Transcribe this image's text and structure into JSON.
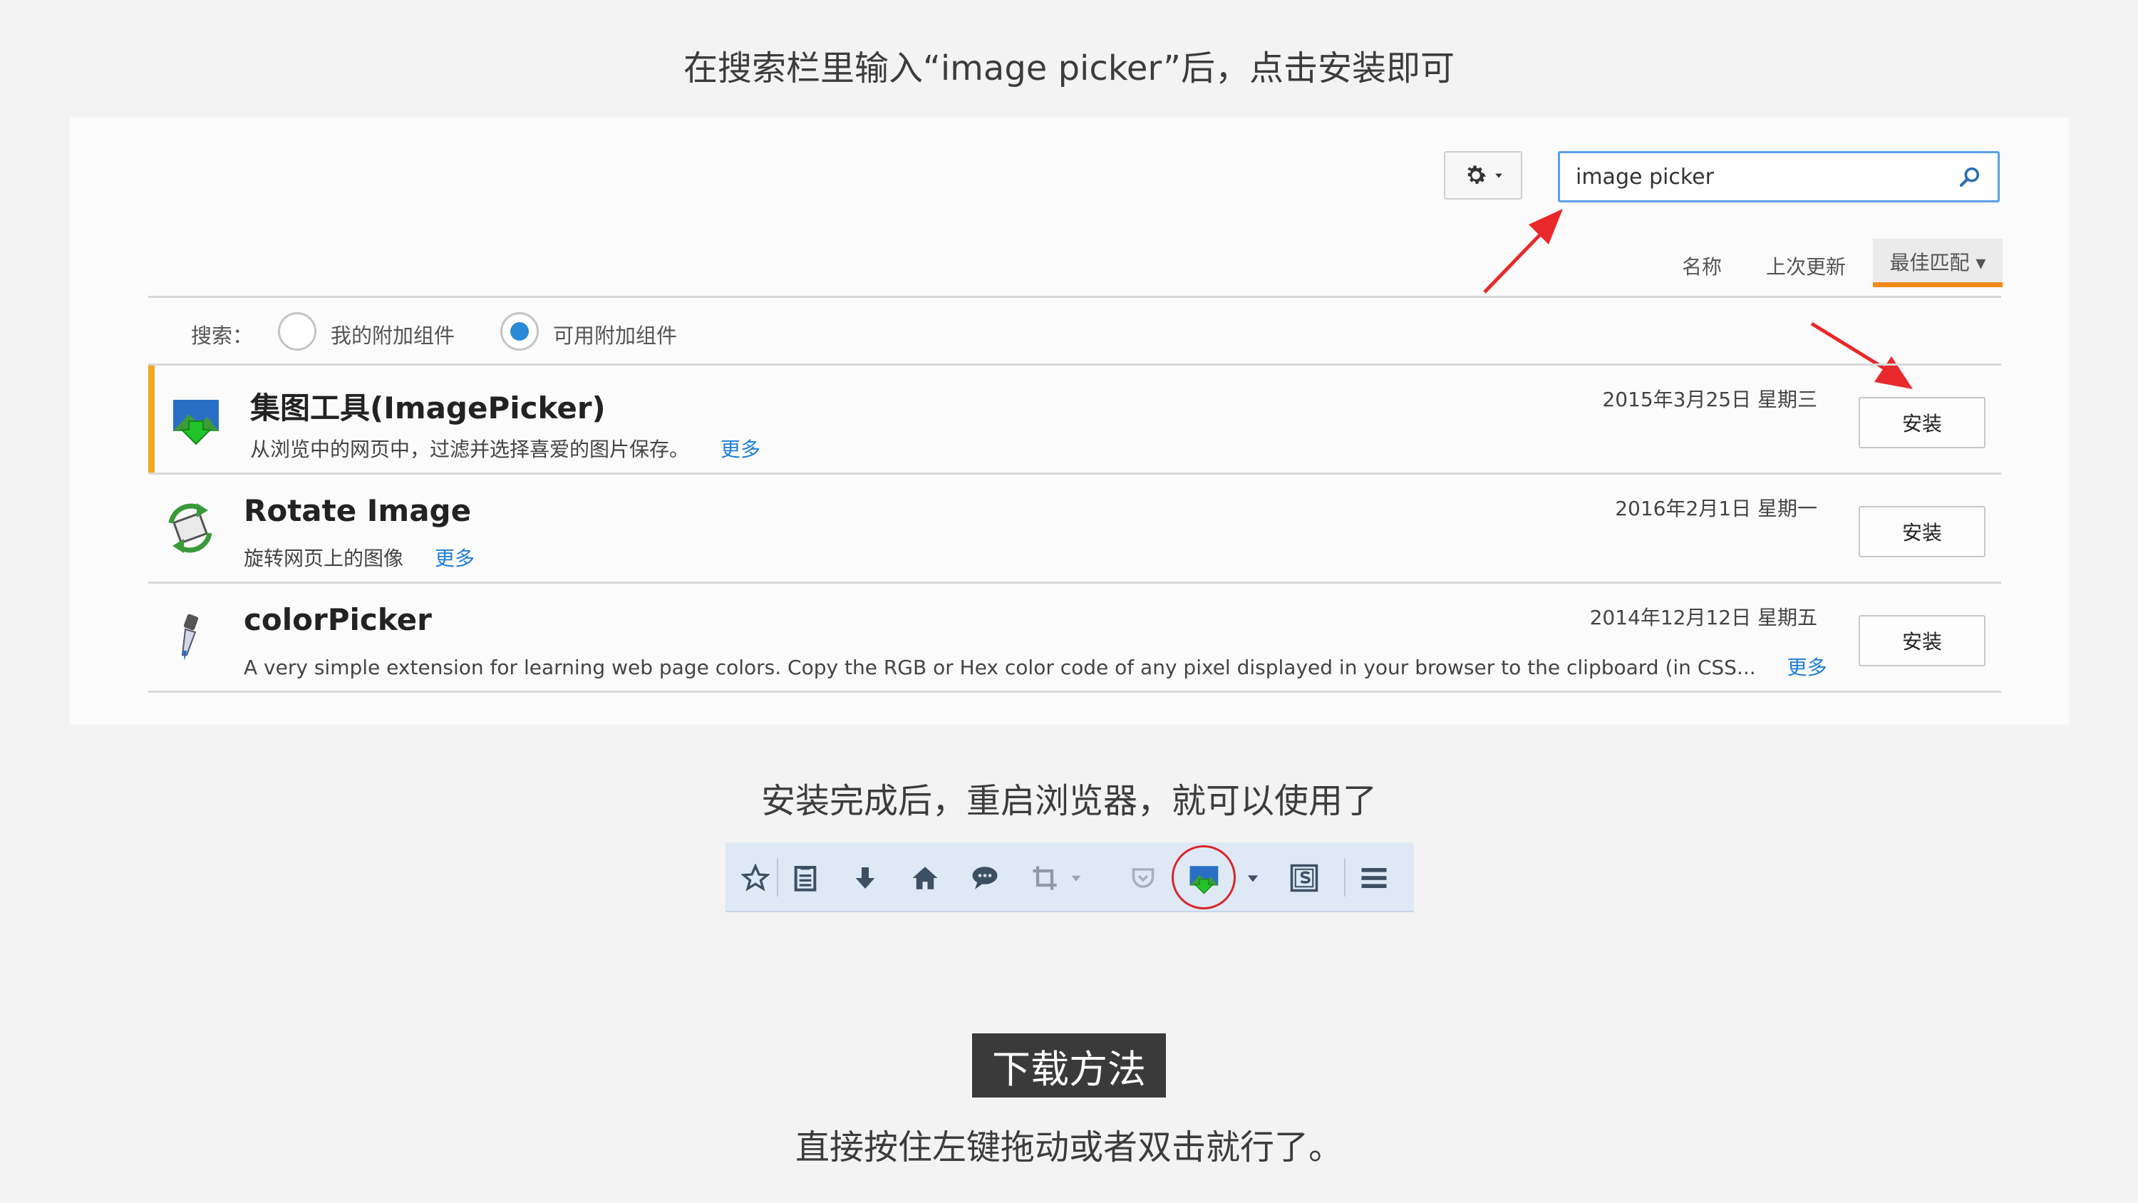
{
  "captions": {
    "top": "在搜索栏里输入“image picker”后，点击安装即可",
    "middle": "安装完成后，重启浏览器，就可以使用了",
    "bottom": "直接按住左键拖动或者双击就行了。"
  },
  "search": {
    "value": "image picker"
  },
  "sort": {
    "name": "名称",
    "last_updated": "上次更新",
    "best_match": "最佳匹配 ▾"
  },
  "filter": {
    "label": "搜索：",
    "options": [
      {
        "label": "我的附加组件",
        "checked": false
      },
      {
        "label": "可用附加组件",
        "checked": true
      }
    ]
  },
  "addons": [
    {
      "title": "集图工具(ImagePicker)",
      "description": "从浏览中的网页中，过滤并选择喜爱的图片保存。",
      "more": "更多",
      "date": "2015年3月25日 星期三",
      "install": "安装",
      "icon": "image-picker-icon"
    },
    {
      "title": "Rotate Image",
      "description": "旋转网页上的图像",
      "more": "更多",
      "date": "2016年2月1日 星期一",
      "install": "安装",
      "icon": "rotate-image-icon"
    },
    {
      "title": "colorPicker",
      "description": "A very simple extension for learning web page colors. Copy the RGB or Hex color code of any pixel displayed in your browser to the clipboard (in CSS...",
      "more": "更多",
      "date": "2014年12月12日 星期五",
      "install": "安装",
      "icon": "color-picker-icon"
    }
  ],
  "toolbar": {
    "icons": [
      "star-icon",
      "reading-list-icon",
      "download-icon",
      "home-icon",
      "chat-icon",
      "crop-icon",
      "dropdown-icon",
      "pocket-icon",
      "image-picker-icon",
      "dropdown-icon",
      "s-icon",
      "menu-icon"
    ]
  },
  "download_method": "下载方法",
  "colors": {
    "accent_orange": "#f08a1c",
    "link_blue": "#1e7dd6",
    "search_border": "#5aa0e6",
    "arrow_red": "#e8282b",
    "highlight_circle": "#d9262b"
  }
}
